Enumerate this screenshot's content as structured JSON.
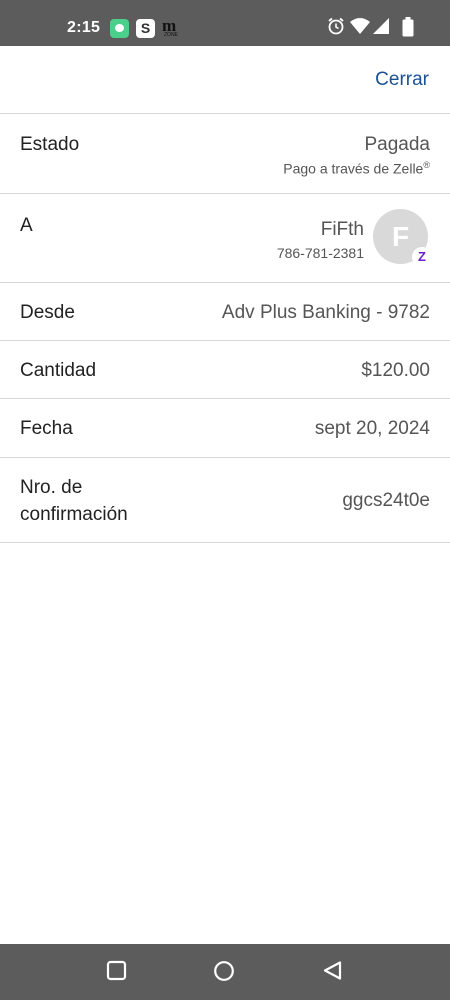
{
  "status_bar": {
    "time": "2:15",
    "notification_s_label": "S",
    "notification_m_label": "m",
    "notification_m_sub": "ZONE"
  },
  "header": {
    "close_label": "Cerrar"
  },
  "details": {
    "estado": {
      "label": "Estado",
      "value": "Pagada",
      "sub": "Pago a través de Zelle",
      "sub_mark": "®"
    },
    "recipient": {
      "label": "A",
      "name": "FiFth",
      "phone": "786-781-2381",
      "avatar_initial": "F",
      "badge": "Z"
    },
    "desde": {
      "label": "Desde",
      "value": "Adv Plus Banking - 9782"
    },
    "cantidad": {
      "label": "Cantidad",
      "value": "$120.00"
    },
    "fecha": {
      "label": "Fecha",
      "value": "sept 20, 2024"
    },
    "confirmacion": {
      "label_line1": "Nro. de",
      "label_line2": "confirmación",
      "value": "ggcs24t0e"
    }
  },
  "colors": {
    "status_bar": "#5c5c5c",
    "link": "#1a5294",
    "zelle_purple": "#6d1ed4",
    "divider": "#d6d6d6"
  },
  "icons": [
    "chat-notification-icon",
    "s-app-icon",
    "m-zone-icon",
    "alarm-icon",
    "wifi-icon",
    "signal-icon",
    "battery-icon",
    "recents-icon",
    "home-icon",
    "back-icon"
  ]
}
